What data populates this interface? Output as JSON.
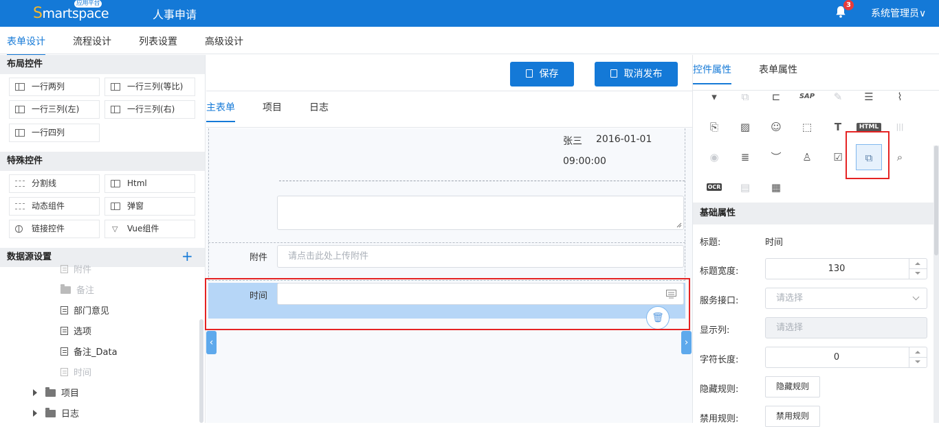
{
  "header": {
    "logo_initial": "S",
    "logo_rest": "martspace",
    "logo_badge": "应用平台",
    "app_title": "人事申请",
    "notification_count": "3",
    "user_name": "系统管理员∨"
  },
  "main_tabs": [
    "表单设计",
    "流程设计",
    "列表设置",
    "高级设计"
  ],
  "left": {
    "layout_title": "布局控件",
    "layout_controls": [
      "一行两列",
      "一行三列(等比)",
      "一行三列(左)",
      "一行三列(右)",
      "一行四列"
    ],
    "special_title": "特殊控件",
    "special_controls": [
      "分割线",
      "Html",
      "动态组件",
      "弹窗",
      "链接控件",
      "Vue组件"
    ],
    "datasource_title": "数据源设置",
    "datasource_add": "+",
    "tree": [
      {
        "label": "附件",
        "kind": "doc",
        "faded": true
      },
      {
        "label": "备注",
        "kind": "folder",
        "faded": true
      },
      {
        "label": "部门意见",
        "kind": "doc",
        "faded": false
      },
      {
        "label": "选项",
        "kind": "doc",
        "faded": false
      },
      {
        "label": "备注_Data",
        "kind": "doc",
        "faded": false
      },
      {
        "label": "时间",
        "kind": "doc",
        "faded": true
      },
      {
        "label": "项目",
        "kind": "folder",
        "faded": false
      },
      {
        "label": "日志",
        "kind": "folder",
        "faded": false
      }
    ]
  },
  "toolbar": {
    "save_label": "保存",
    "unpublish_label": "取消发布"
  },
  "form_tabs": [
    "主表单",
    "项目",
    "日志"
  ],
  "canvas": {
    "signer_name": "张三",
    "signer_date": "2016-01-01",
    "signer_time": "09:00:00",
    "attachment_label": "附件",
    "attachment_placeholder": "请点击此处上传附件",
    "time_label": "时间",
    "delete_icon": "🗑"
  },
  "right": {
    "tabs": [
      "控件属性",
      "表单属性"
    ],
    "icons": [
      {
        "glyph": "▾",
        "name": "dropdown-icon",
        "faded": false
      },
      {
        "glyph": "⧉",
        "name": "copy-icon",
        "faded": true
      },
      {
        "glyph": "⊏",
        "name": "merge-icon",
        "faded": false
      },
      {
        "glyph": "SAP",
        "name": "sap-icon",
        "faded": false
      },
      {
        "glyph": "✎",
        "name": "sign-icon",
        "faded": true
      },
      {
        "glyph": "☰",
        "name": "list-doc-icon",
        "faded": false
      },
      {
        "glyph": "⌇",
        "name": "paperclip-icon",
        "faded": false
      },
      {
        "glyph": "⎘",
        "name": "file-icon",
        "faded": false
      },
      {
        "glyph": "▨",
        "name": "image-icon",
        "faded": false
      },
      {
        "glyph": "☺",
        "name": "user-icon",
        "faded": false
      },
      {
        "glyph": "⬚",
        "name": "node-icon",
        "faded": false
      },
      {
        "glyph": "T",
        "name": "text-box-icon",
        "faded": false
      },
      {
        "glyph": "HTML",
        "name": "html-icon",
        "faded": false
      },
      {
        "glyph": "|||",
        "name": "barcode-icon",
        "faded": true
      },
      {
        "glyph": "◉",
        "name": "toggle-icon",
        "faded": true
      },
      {
        "glyph": "≣",
        "name": "align-icon",
        "faded": false
      },
      {
        "glyph": "︶",
        "name": "eye-closed-icon",
        "faded": false
      },
      {
        "glyph": "♙",
        "name": "stamp-icon",
        "faded": false
      },
      {
        "glyph": "☑",
        "name": "check-doc-icon",
        "faded": false
      },
      {
        "glyph": "⧉",
        "name": "time-control-icon",
        "faded": false
      },
      {
        "glyph": "⌕",
        "name": "search-doc-icon",
        "faded": false
      },
      {
        "glyph": "OCR",
        "name": "ocr-icon",
        "faded": false
      },
      {
        "glyph": "▤",
        "name": "sheet-icon",
        "faded": true
      },
      {
        "glyph": "▦",
        "name": "qrcode-icon",
        "faded": false
      }
    ],
    "props_title": "基础属性",
    "props": {
      "title_label": "标题:",
      "title_value": "时间",
      "width_label": "标题宽度:",
      "width_value": "130",
      "service_label": "服务接口:",
      "service_placeholder": "请选择",
      "display_label": "显示列:",
      "display_placeholder": "请选择",
      "length_label": "字符长度:",
      "length_value": "0",
      "hide_label": "隐藏规则:",
      "hide_button": "隐藏规则",
      "disable_label": "禁用规则:",
      "disable_button": "禁用规则"
    }
  }
}
